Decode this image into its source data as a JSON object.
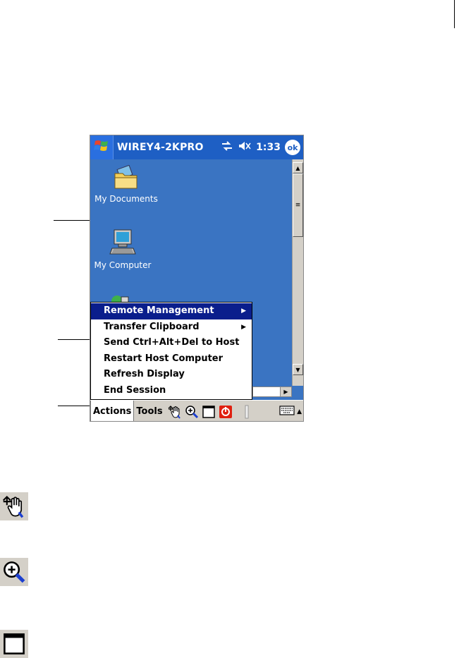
{
  "title_bar": {
    "app_name": "WIREY4-2KPRO",
    "time": "1:33",
    "ok_label": "ok",
    "icons": [
      "windows-start-icon",
      "connectivity-icon",
      "speaker-muted-icon"
    ]
  },
  "desktop": {
    "icons": [
      {
        "label": "My Documents",
        "icon": "folder-icon"
      },
      {
        "label": "My Computer",
        "icon": "computer-icon"
      }
    ]
  },
  "context_menu": {
    "items": [
      {
        "label": "Remote Management",
        "submenu": true,
        "highlighted": true
      },
      {
        "label": "Transfer Clipboard",
        "submenu": true,
        "highlighted": false
      },
      {
        "label": "Send Ctrl+Alt+Del to Host",
        "submenu": false,
        "highlighted": false
      },
      {
        "label": "Restart Host Computer",
        "submenu": false,
        "highlighted": false
      },
      {
        "label": "Refresh Display",
        "submenu": false,
        "highlighted": false
      },
      {
        "label": "End Session",
        "submenu": false,
        "highlighted": false
      }
    ]
  },
  "command_bar": {
    "actions_label": "Actions",
    "tools_label": "Tools",
    "tool_icons": [
      "pan-hand-icon",
      "zoom-icon",
      "window-icon",
      "power-icon",
      "slider-icon"
    ],
    "keyboard_icon": "keyboard-icon"
  },
  "legend_icons": [
    "pan-hand-icon",
    "zoom-icon",
    "window-icon"
  ],
  "colors": {
    "title_bar": "#1e5fc4",
    "desktop": "#3a74c2",
    "menu_highlight": "#0a1e8c",
    "command_bar": "#d4d0c8"
  }
}
